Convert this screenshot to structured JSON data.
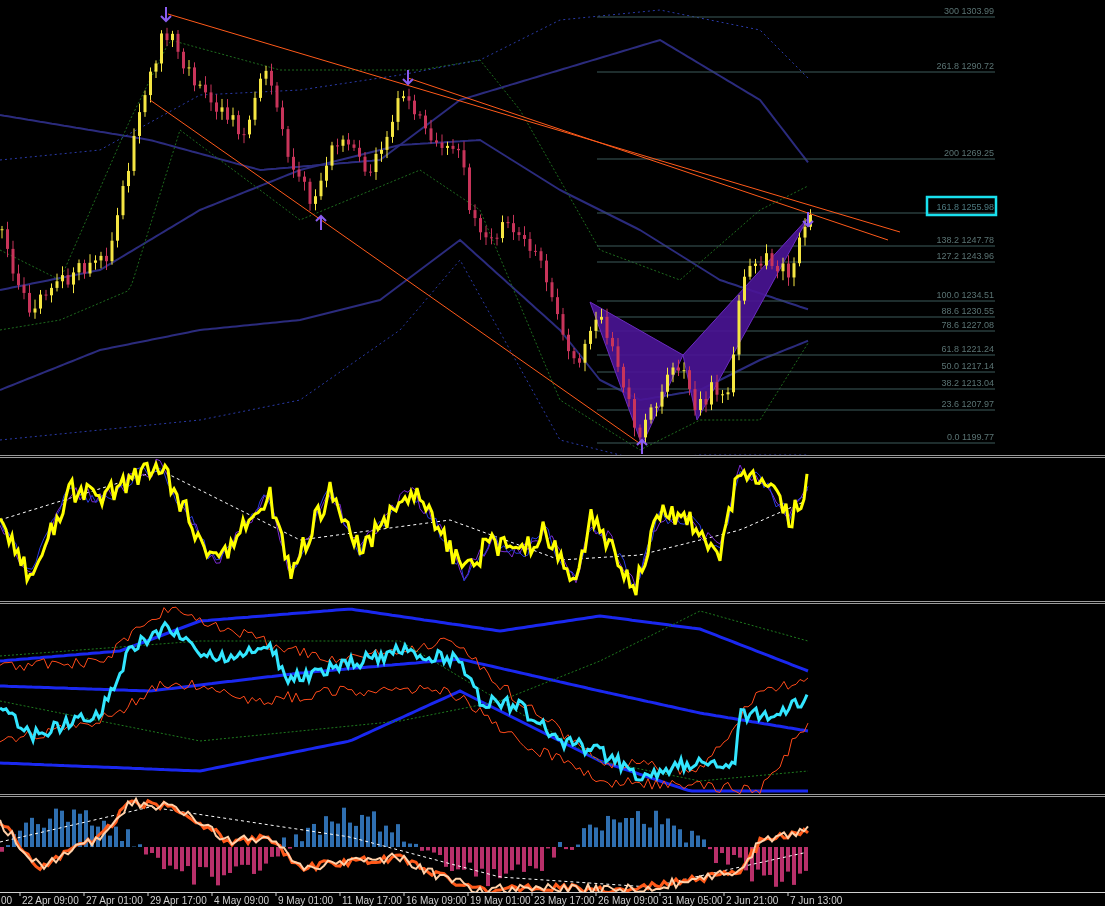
{
  "fib_levels": [
    {
      "label": "300 1303.99",
      "highlighted": false
    },
    {
      "label": "261.8 1290.72",
      "highlighted": false
    },
    {
      "label": "200 1269.25",
      "highlighted": false
    },
    {
      "label": "161.8 1255.98",
      "highlighted": true
    },
    {
      "label": "138.2 1247.78",
      "highlighted": false
    },
    {
      "label": "127.2 1243.96",
      "highlighted": false
    },
    {
      "label": "100.0 1234.51",
      "highlighted": false
    },
    {
      "label": "88.6 1230.55",
      "highlighted": false
    },
    {
      "label": "78.6 1227.08",
      "highlighted": false
    },
    {
      "label": "61.8 1221.24",
      "highlighted": false
    },
    {
      "label": "50.0 1217.14",
      "highlighted": false
    },
    {
      "label": "38.2 1213.04",
      "highlighted": false
    },
    {
      "label": "23.6 1207.97",
      "highlighted": false
    },
    {
      "label": "0.0 1199.77",
      "highlighted": false
    }
  ],
  "time_axis": {
    "labels": [
      "00",
      "22 Apr 09:00",
      "27 Apr 01:00",
      "29 Apr 17:00",
      "4 May 09:00",
      "9 May 01:00",
      "11 May 17:00",
      "16 May 09:00",
      "19 May 01:00",
      "23 May 17:00",
      "26 May 09:00",
      "31 May 05:00",
      "2 Jun 21:00",
      "7 Jun 13:00"
    ]
  }
}
